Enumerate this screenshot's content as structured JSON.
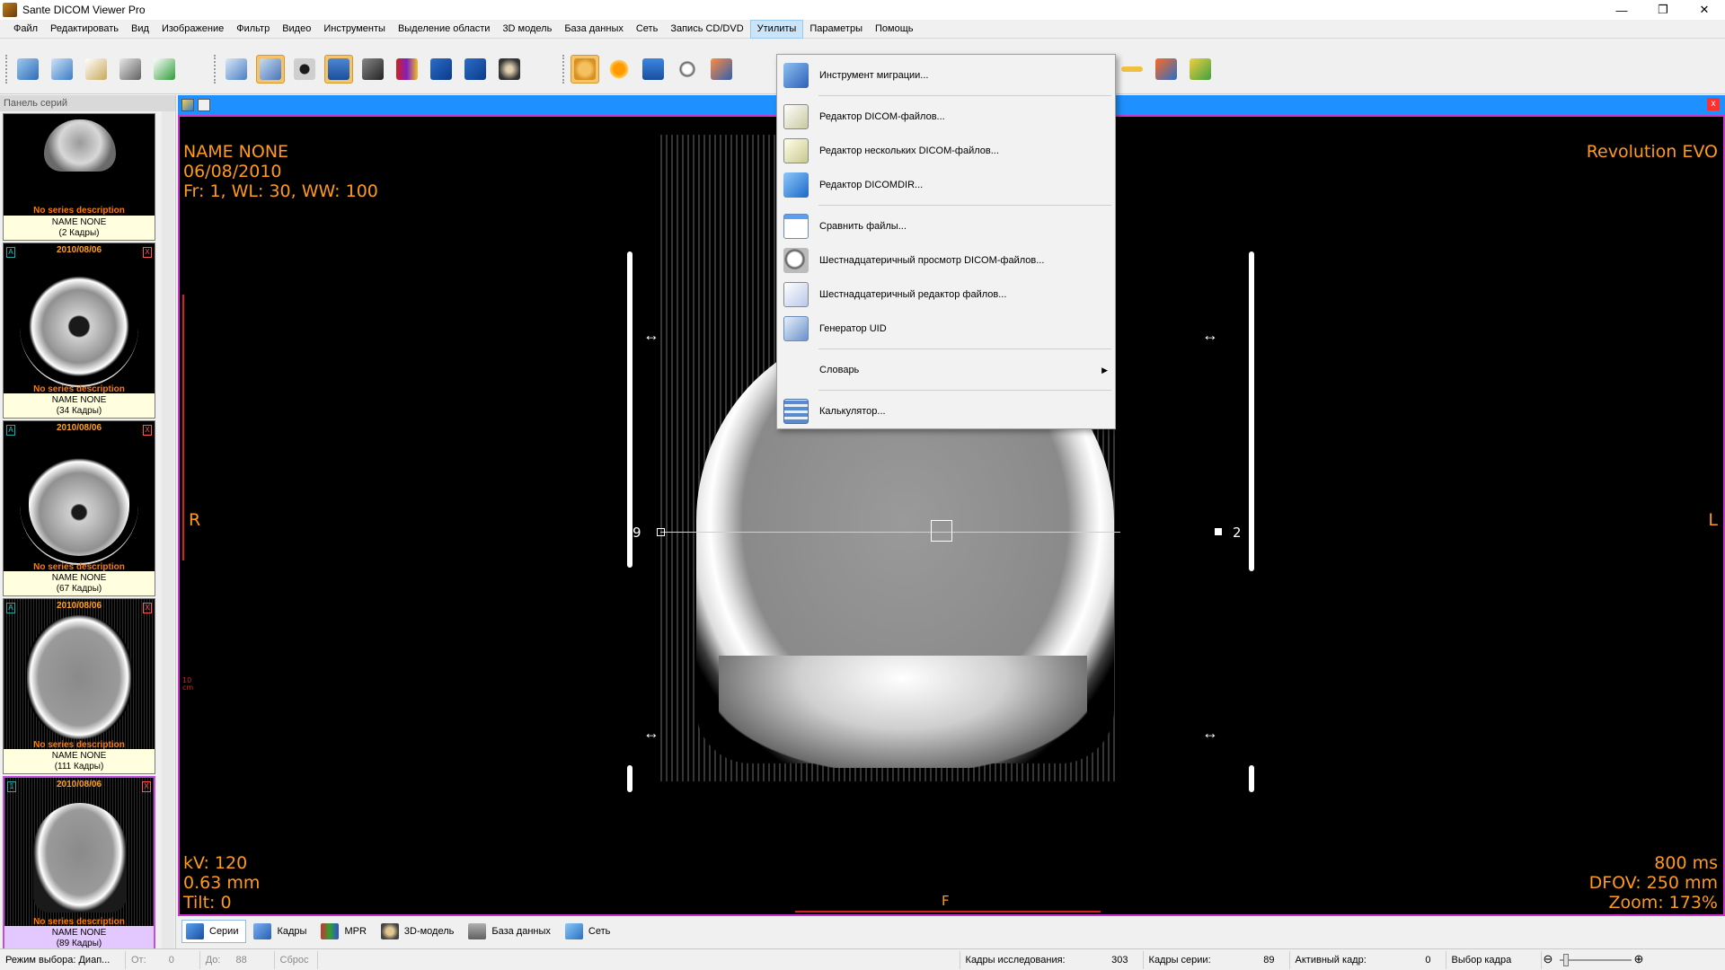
{
  "window": {
    "title": "Sante DICOM Viewer Pro",
    "controls": [
      "—",
      "❐",
      "✕"
    ]
  },
  "menu": [
    "Файл",
    "Редактировать",
    "Вид",
    "Изображение",
    "Фильтр",
    "Видео",
    "Инструменты",
    "Выделение области",
    "3D модель",
    "База данных",
    "Сеть",
    "Запись CD/DVD",
    "Утилиты",
    "Параметры",
    "Помощь"
  ],
  "menu_active": "Утилиты",
  "side_panel": {
    "header": "Панель серий",
    "series": [
      {
        "date": "",
        "desc": "No series description",
        "name": "NAME NONE",
        "frames": "(2 Кадры)"
      },
      {
        "date": "2010/08/06",
        "desc": "No series description",
        "name": "NAME NONE",
        "frames": "(34 Кадры)"
      },
      {
        "date": "2010/08/06",
        "desc": "No series description",
        "name": "NAME NONE",
        "frames": "(67 Кадры)"
      },
      {
        "date": "2010/08/06",
        "desc": "No series description",
        "name": "NAME NONE",
        "frames": "(111 Кадры)"
      },
      {
        "date": "2010/08/06",
        "desc": "No series description",
        "name": "NAME NONE",
        "frames": "(89 Кадры)"
      }
    ]
  },
  "viewer": {
    "top_left": [
      "NAME NONE",
      "06/08/2010",
      "Fr: 1, WL: 30, WW: 100"
    ],
    "top_right": "Revolution EVO",
    "bottom_left": [
      "kV: 120",
      "0.63 mm",
      "Tilt: 0"
    ],
    "bottom_right": [
      "800 ms",
      "DFOV: 250 mm",
      "Zoom: 173%"
    ],
    "orient_left": "R",
    "orient_right": "L",
    "orient_bottom": "F",
    "ruler_label": "10 cm",
    "marker_left": "9",
    "marker_right": "2"
  },
  "utilities_menu": [
    {
      "label": "Инструмент миграции...",
      "icon": "migration-tool-icon"
    },
    {
      "label": "Редактор DICOM-файлов...",
      "icon": "dicom-editor-icon"
    },
    {
      "label": "Редактор нескольких DICOM-файлов...",
      "icon": "multi-dicom-editor-icon"
    },
    {
      "label": "Редактор DICOMDIR...",
      "icon": "dicomdir-editor-icon"
    },
    {
      "label": "Сравнить файлы...",
      "icon": "compare-files-icon"
    },
    {
      "label": "Шестнадцатеричный просмотр DICOM-файлов...",
      "icon": "hex-viewer-icon"
    },
    {
      "label": "Шестнадцатеричный редактор файлов...",
      "icon": "hex-editor-icon"
    },
    {
      "label": "Генератор UID",
      "icon": "uid-generator-icon"
    },
    {
      "label": "Словарь",
      "icon": ""
    },
    {
      "label": "Калькулятор...",
      "icon": "calculator-icon"
    }
  ],
  "bottom_tabs": [
    "Серии",
    "Кадры",
    "MPR",
    "3D-модель",
    "База данных",
    "Сеть"
  ],
  "status": {
    "mode": "Режим выбора: Диап...",
    "from_label": "От:",
    "from_value": "0",
    "to_label": "До:",
    "to_value": "88",
    "reset": "Сброс",
    "study_frames_label": "Кадры исследования:",
    "study_frames_value": "303",
    "series_frames_label": "Кадры серии:",
    "series_frames_value": "89",
    "active_frame_label": "Активный кадр:",
    "active_frame_value": "0",
    "frame_select": "Выбор кадра"
  },
  "colors": {
    "accent": "#1e90ff",
    "overlay": "#ff9a1a",
    "viewport_border": "#cc33cc",
    "series_desc": "#ff7a00"
  }
}
